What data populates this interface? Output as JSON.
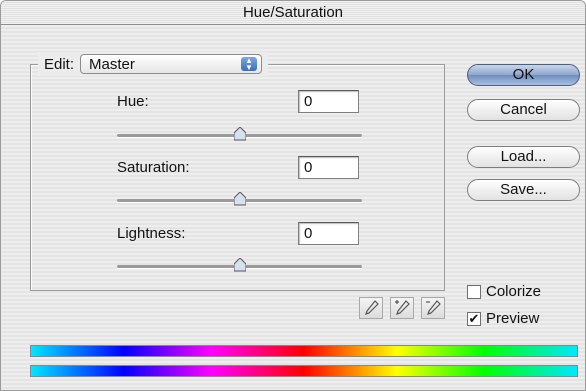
{
  "window": {
    "title": "Hue/Saturation"
  },
  "edit": {
    "label": "Edit:",
    "selected": "Master"
  },
  "adjustments": [
    {
      "label": "Hue:",
      "value": "0",
      "slider_fraction": 0.5
    },
    {
      "label": "Saturation:",
      "value": "0",
      "slider_fraction": 0.5
    },
    {
      "label": "Lightness:",
      "value": "0",
      "slider_fraction": 0.5
    }
  ],
  "buttons": {
    "ok": "OK",
    "cancel": "Cancel",
    "load": "Load...",
    "save": "Save..."
  },
  "options": {
    "colorize": {
      "label": "Colorize",
      "checked": false
    },
    "preview": {
      "label": "Preview",
      "checked": true
    }
  },
  "icons": [
    "eyedropper-icon",
    "eyedropper-plus-icon",
    "eyedropper-minus-icon",
    "popup-arrows-icon",
    "slider-thumb-icon",
    "checkmark-icon"
  ],
  "colors": {
    "default_button": "#8ea6cc",
    "accent": "#3b6dbb"
  }
}
